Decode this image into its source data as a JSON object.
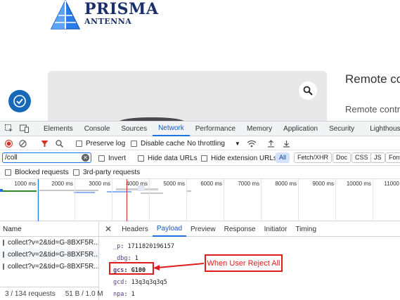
{
  "website": {
    "brand_name": "PRISMA",
    "brand_sub": "ANTENNA",
    "product_title": "Remote co",
    "product_subtitle": "Remote contr",
    "colors": {
      "brand": "#1b2f6b",
      "consent_button": "#1668b8"
    }
  },
  "devtools": {
    "panel_tabs": [
      "Elements",
      "Console",
      "Sources",
      "Network",
      "Performance",
      "Memory",
      "Application",
      "Security",
      "Lighthouse"
    ],
    "active_panel_tab": "Network",
    "toolbar": {
      "preserve_log": "Preserve log",
      "disable_cache": "Disable cache",
      "throttling": "No throttling"
    },
    "filter": {
      "value": "/coll",
      "invert": "Invert",
      "hide_data_urls": "Hide data URLs",
      "hide_extension_urls": "Hide extension URLs",
      "type_chips": [
        "All",
        "Fetch/XHR",
        "Doc",
        "CSS",
        "JS",
        "Font"
      ],
      "active_chip": "All"
    },
    "blocked_requests": "Blocked requests",
    "third_party_requests": "3rd-party requests",
    "timeline": {
      "ticks": [
        "1000 ms",
        "2000 ms",
        "3000 ms",
        "4000 ms",
        "5000 ms",
        "6000 ms",
        "7000 ms",
        "8000 ms",
        "9000 ms",
        "10000 ms",
        "11000"
      ]
    },
    "requests": {
      "name_header": "Name",
      "rows": [
        "collect?v=2&tid=G-8BXF5R...",
        "collect?v=2&tid=G-8BXF5R...",
        "collect?v=2&tid=G-8BXF5R..."
      ],
      "status_count": "3 / 134 requests",
      "status_size": "51 B / 1.0 M"
    },
    "detail": {
      "tabs": [
        "Headers",
        "Payload",
        "Preview",
        "Response",
        "Initiator",
        "Timing"
      ],
      "active_tab": "Payload",
      "payload": [
        {
          "key": "_p",
          "value": "1711820196157"
        },
        {
          "key": "_dbg",
          "value": "1"
        },
        {
          "key": "gcs",
          "value": "G100"
        },
        {
          "key": "gcd",
          "value": "13q3q3q3q5"
        },
        {
          "key": "npa",
          "value": "1"
        }
      ]
    }
  },
  "annotation": {
    "label": "When User Reject All",
    "color": "#e01c1c"
  }
}
